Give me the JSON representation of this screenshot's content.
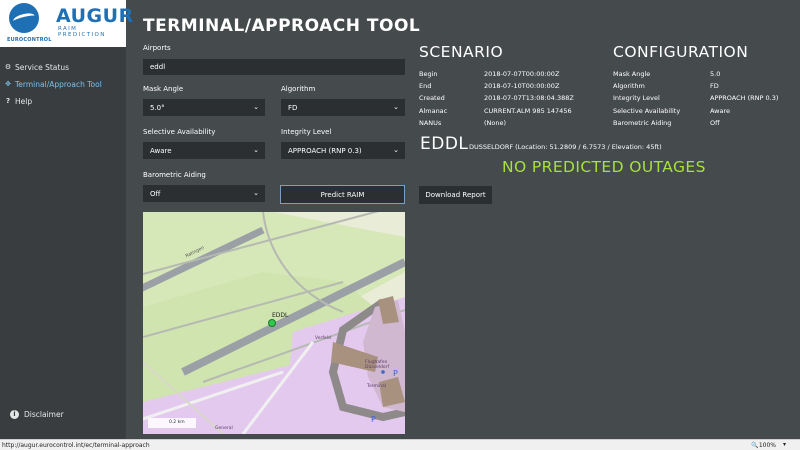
{
  "logo": {
    "brand": "AUGUR",
    "subtitle": "RAIM PREDICTION",
    "org": "EUROCONTROL"
  },
  "sidebar": {
    "items": [
      {
        "label": "Service Status",
        "icon": "gear-icon"
      },
      {
        "label": "Terminal/Approach Tool",
        "icon": "target-icon"
      },
      {
        "label": "Help",
        "icon": "question-icon"
      }
    ],
    "disclaimer": "Disclaimer"
  },
  "page": {
    "title": "TERMINAL/APPROACH TOOL"
  },
  "form": {
    "airports_label": "Airports",
    "airports_value": "eddl",
    "mask_angle_label": "Mask Angle",
    "mask_angle_value": "5.0°",
    "algorithm_label": "Algorithm",
    "algorithm_value": "FD",
    "sa_label": "Selective Availability",
    "sa_value": "Aware",
    "integrity_label": "Integrity Level",
    "integrity_value": "APPROACH (RNP 0.3)",
    "baro_label": "Barometric Aiding",
    "baro_value": "Off",
    "predict_label": "Predict RAIM"
  },
  "map": {
    "airport_label": "EDDL",
    "road_labels": [
      "Ratingen",
      "Flughafen Düsseldorf",
      "Terminal",
      "Verfeld",
      "General"
    ],
    "scale": "0.2 km"
  },
  "scenario": {
    "title": "SCENARIO",
    "rows": [
      {
        "key": "Begin",
        "value": "2018-07-07T00:00:00Z"
      },
      {
        "key": "End",
        "value": "2018-07-10T00:00:00Z"
      },
      {
        "key": "Created",
        "value": "2018-07-07T13:08:04.388Z"
      },
      {
        "key": "Almanac",
        "value": "CURRENT.ALM 985 147456"
      },
      {
        "key": "NANUs",
        "value": "(None)"
      }
    ]
  },
  "configuration": {
    "title": "CONFIGURATION",
    "rows": [
      {
        "key": "Mask Angle",
        "value": "5.0"
      },
      {
        "key": "Algorithm",
        "value": "FD"
      },
      {
        "key": "Integrity Level",
        "value": "APPROACH (RNP 0.3)"
      },
      {
        "key": "Selective Availability",
        "value": "Aware"
      },
      {
        "key": "Barometric Aiding",
        "value": "Off"
      }
    ]
  },
  "result": {
    "icao": "EDDL",
    "location": "DUSSELDORF (Location: 51.2809 / 6.7573 / Elevation: 45ft)",
    "status": "NO PREDICTED OUTAGES",
    "status_color": "#a6e23a",
    "download_label": "Download Report"
  },
  "status_bar": {
    "url": "http://augur.eurocontrol.int/ec/terminal-approach",
    "zoom": "100%"
  }
}
